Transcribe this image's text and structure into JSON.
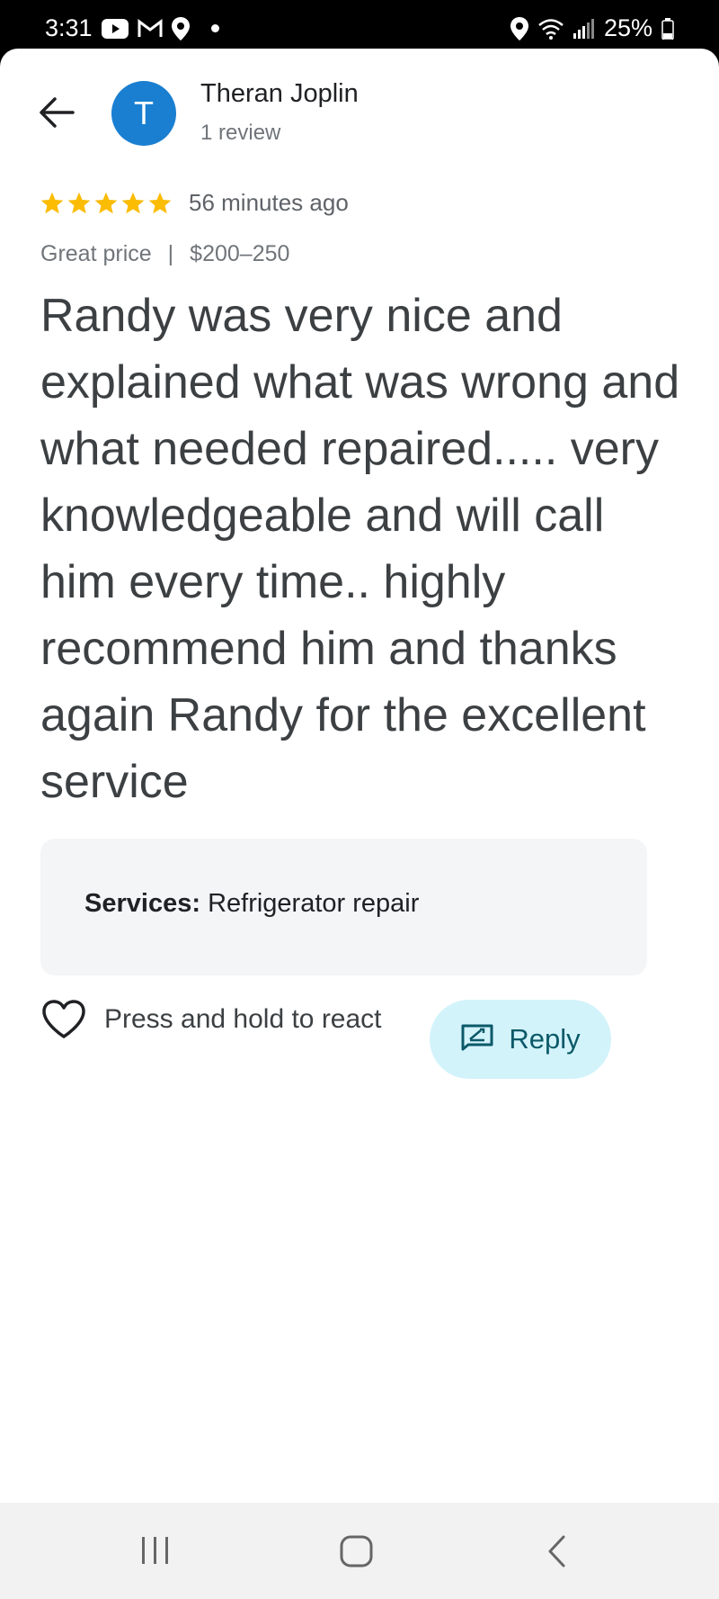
{
  "status_bar": {
    "time": "3:31",
    "battery": "25%",
    "icons_left": [
      "youtube-icon",
      "gmail-icon",
      "location-icon",
      "notification-dot"
    ],
    "icons_right": [
      "location-icon",
      "wifi-icon",
      "signal-icon",
      "battery-icon"
    ]
  },
  "header": {
    "back_icon": "arrow-back-icon",
    "avatar_letter": "T",
    "avatar_color": "#1a7fd1",
    "author_name": "Theran Joplin",
    "review_count": "1 review"
  },
  "review": {
    "rating": 5,
    "max_rating": 5,
    "star_color": "#fbbc04",
    "time": "56 minutes ago",
    "price_label": "Great price",
    "separator": "|",
    "price_range": "$200–250",
    "text": "Randy was very nice and explained what was wrong and what needed repaired..... very knowledgeable and will call him every time.. highly recommend him and thanks again Randy for the excellent service"
  },
  "services": {
    "label": "Services:",
    "value": "Refrigerator repair"
  },
  "actions": {
    "react_label": "Press and hold to react",
    "reply_label": "Reply",
    "reply_bg": "#d3f3fb"
  },
  "nav": {
    "items": [
      "recent-apps-icon",
      "home-icon",
      "back-icon"
    ]
  }
}
